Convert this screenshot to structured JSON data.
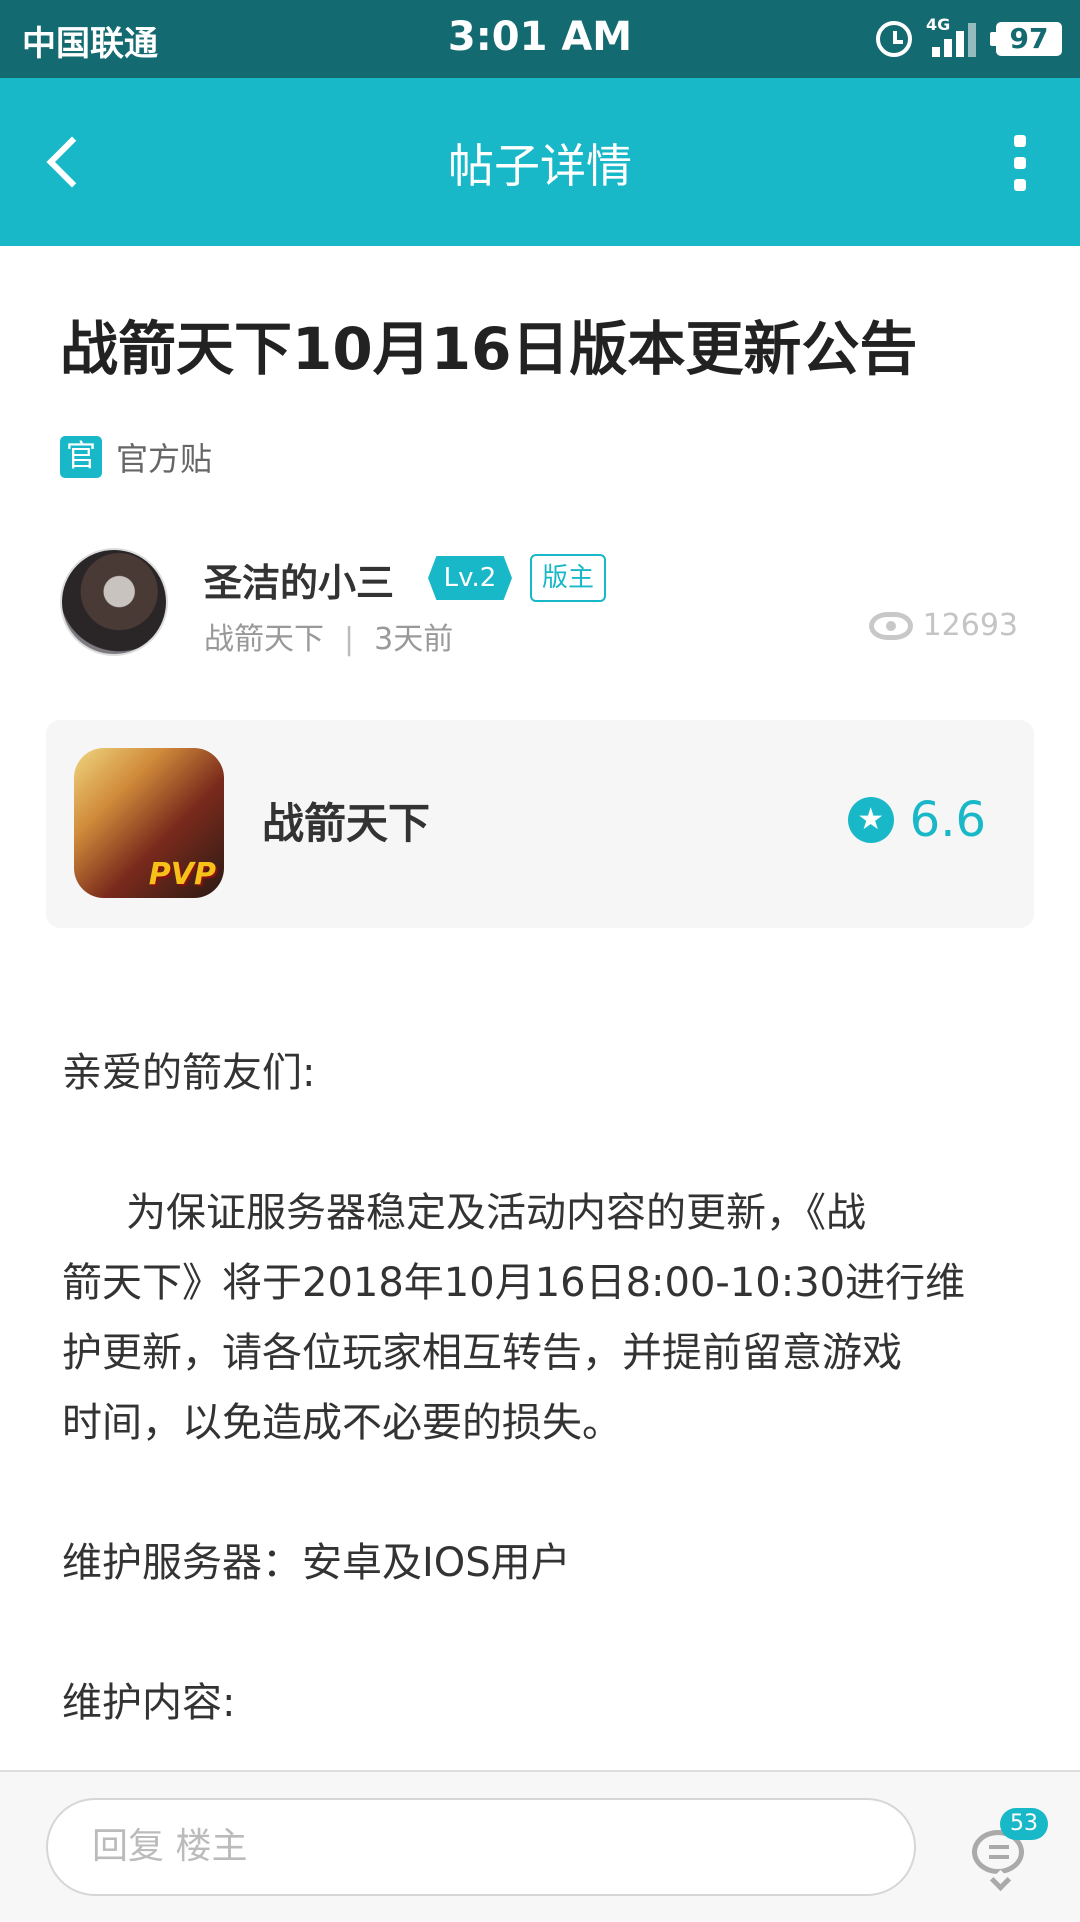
{
  "status_bar": {
    "carrier": "中国联通",
    "time": "3:01 AM",
    "network": "4G",
    "battery": "97"
  },
  "header": {
    "title": "帖子详情"
  },
  "post": {
    "title": "战箭天下10月16日版本更新公告",
    "official_badge": "官",
    "official_label": "官方贴",
    "author": {
      "name": "圣洁的小三",
      "level": "Lv.2",
      "role": "版主",
      "forum": "战箭天下",
      "separator": "|",
      "time": "3天前"
    },
    "views": "12693"
  },
  "game_card": {
    "icon_text": "PVP",
    "name": "战箭天下",
    "rating": "6.6",
    "star_glyph": "★"
  },
  "content": {
    "greeting": "亲爱的箭友们:",
    "paragraph1_lines": [
      "为保证服务器稳定及活动内容的更新，《战",
      "箭天下》将于2018年10月16日8:00-10:30进行维",
      "护更新，请各位玩家相互转告，并提前留意游戏",
      "时间，以免造成不必要的损失。"
    ],
    "servers": "维护服务器：安卓及IOS用户",
    "maintenance_content": "维护内容:"
  },
  "bottom_bar": {
    "reply_placeholder": "回复  楼主",
    "comment_count": "53"
  },
  "colors": {
    "status_bar": "#136b71",
    "accent": "#18b8c8",
    "text": "#333333",
    "muted": "#999999"
  },
  "icons": [
    "back-icon",
    "more-icon",
    "alarm-icon",
    "signal-icon",
    "battery-icon",
    "eye-icon",
    "star-icon",
    "comment-icon"
  ]
}
